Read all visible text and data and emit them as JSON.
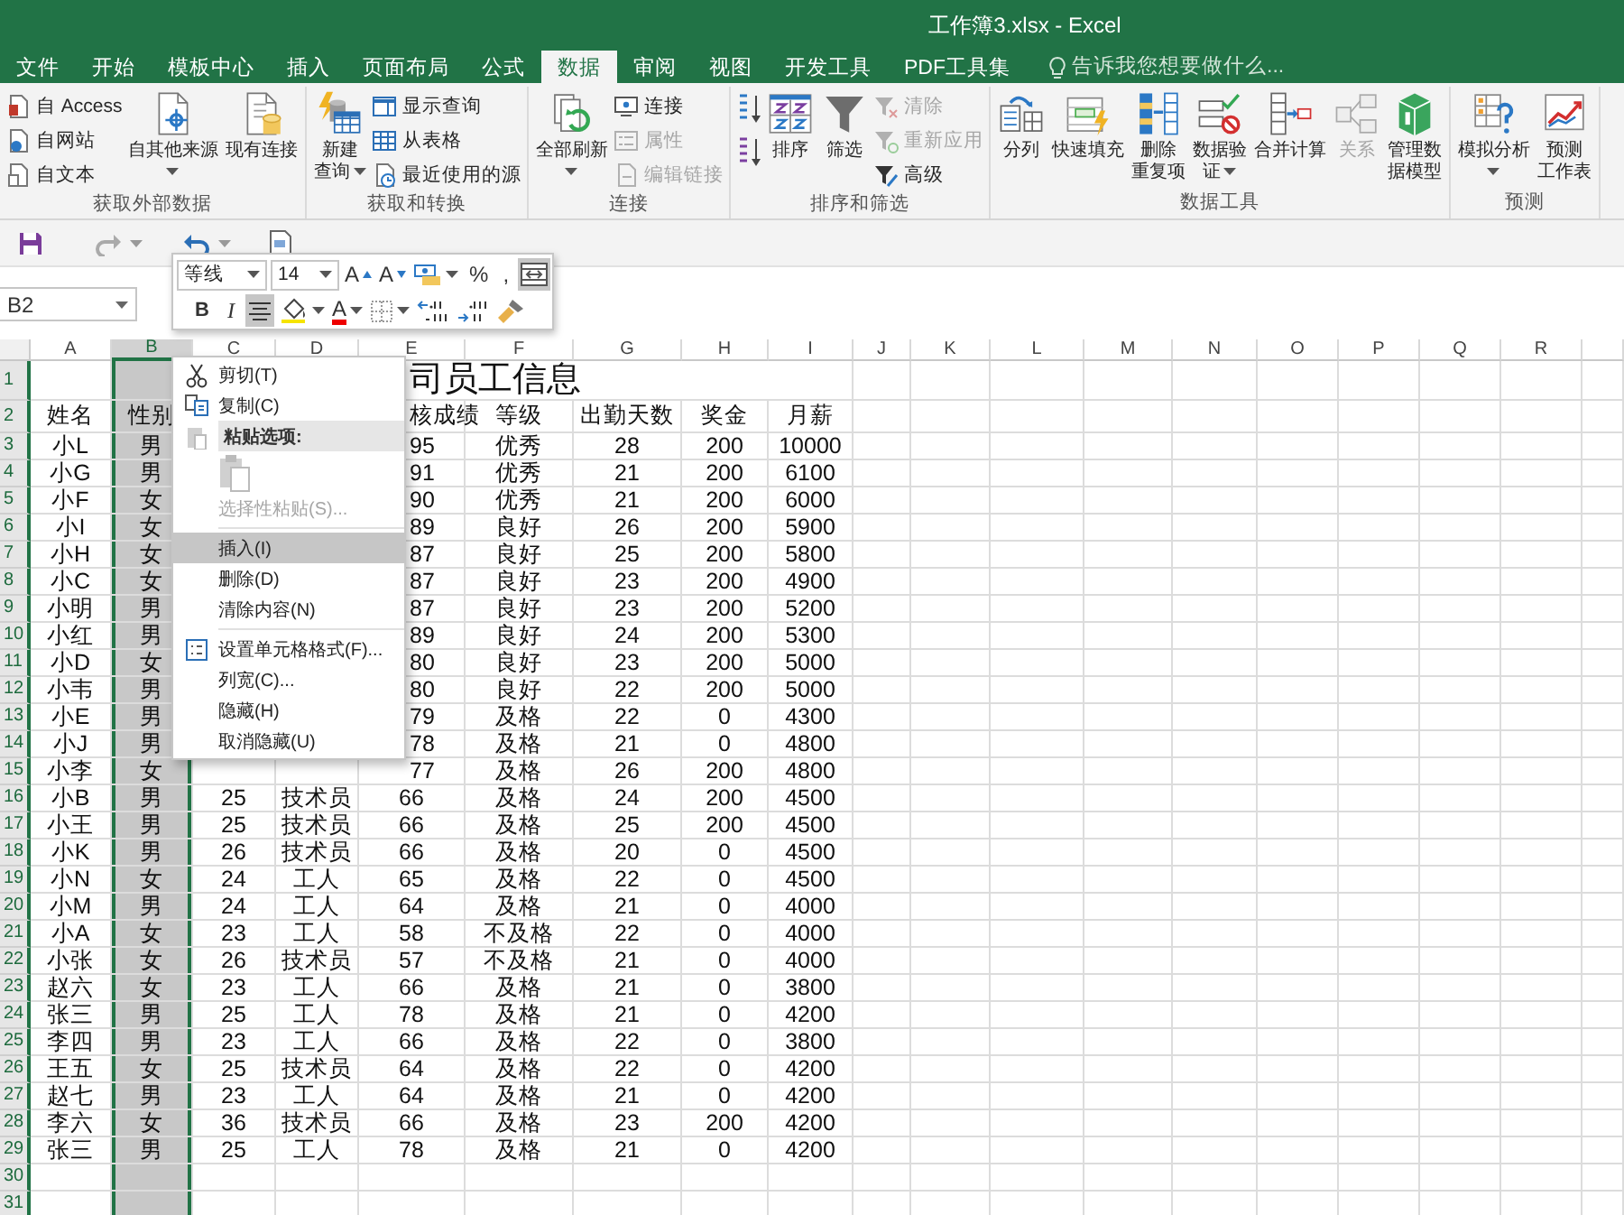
{
  "window": {
    "title": "工作簿3.xlsx - Excel"
  },
  "ribbon_tabs": [
    {
      "label": "文件",
      "selected": false
    },
    {
      "label": "开始",
      "selected": false
    },
    {
      "label": "模板中心",
      "selected": false
    },
    {
      "label": "插入",
      "selected": false
    },
    {
      "label": "页面布局",
      "selected": false
    },
    {
      "label": "公式",
      "selected": false
    },
    {
      "label": "数据",
      "selected": true
    },
    {
      "label": "审阅",
      "selected": false
    },
    {
      "label": "视图",
      "selected": false
    },
    {
      "label": "开发工具",
      "selected": false
    },
    {
      "label": "PDF工具集",
      "selected": false
    }
  ],
  "tell_me": {
    "placeholder": "告诉我您想要做什么..."
  },
  "ribbon_groups": [
    {
      "label": "获取外部数据",
      "items": [
        {
          "kind": "stack",
          "items": [
            {
              "label": "自 Access",
              "disabled": false
            },
            {
              "label": "自网站",
              "disabled": false
            },
            {
              "label": "自文本",
              "disabled": false
            }
          ]
        },
        {
          "kind": "large",
          "lines": [
            "自其他来源"
          ],
          "dropdown": true,
          "disabled": false
        },
        {
          "kind": "large",
          "lines": [
            "现有连接"
          ],
          "dropdown": false,
          "disabled": false
        }
      ]
    },
    {
      "label": "获取和转换",
      "items": [
        {
          "kind": "large",
          "lines": [
            "新建",
            "查询"
          ],
          "dropdown": true,
          "disabled": false
        },
        {
          "kind": "stack",
          "items": [
            {
              "label": "显示查询",
              "disabled": false
            },
            {
              "label": "从表格",
              "disabled": false
            },
            {
              "label": "最近使用的源",
              "disabled": false
            }
          ]
        }
      ]
    },
    {
      "label": "连接",
      "items": [
        {
          "kind": "large",
          "lines": [
            "全部刷新"
          ],
          "dropdown": true,
          "disabled": false
        },
        {
          "kind": "stack",
          "items": [
            {
              "label": "连接",
              "disabled": false
            },
            {
              "label": "属性",
              "disabled": true
            },
            {
              "label": "编辑链接",
              "disabled": true
            }
          ]
        }
      ]
    },
    {
      "label": "排序和筛选",
      "items": [
        {
          "kind": "sort-pair"
        },
        {
          "kind": "large",
          "lines": [
            "排序"
          ],
          "dropdown": false,
          "disabled": false
        },
        {
          "kind": "large",
          "lines": [
            "筛选"
          ],
          "dropdown": false,
          "disabled": false
        },
        {
          "kind": "stack",
          "items": [
            {
              "label": "清除",
              "disabled": true
            },
            {
              "label": "重新应用",
              "disabled": true
            },
            {
              "label": "高级",
              "disabled": false
            }
          ]
        }
      ]
    },
    {
      "label": "数据工具",
      "items": [
        {
          "kind": "large",
          "lines": [
            "分列"
          ],
          "dropdown": false,
          "disabled": false
        },
        {
          "kind": "large",
          "lines": [
            "快速填充"
          ],
          "dropdown": false,
          "disabled": false
        },
        {
          "kind": "large",
          "lines": [
            "删除",
            "重复项"
          ],
          "dropdown": false,
          "disabled": false
        },
        {
          "kind": "large",
          "lines": [
            "数据验",
            "证"
          ],
          "dropdown": true,
          "disabled": false
        },
        {
          "kind": "large",
          "lines": [
            "合并计算"
          ],
          "dropdown": false,
          "disabled": false
        },
        {
          "kind": "large",
          "lines": [
            "关系"
          ],
          "dropdown": false,
          "disabled": true
        },
        {
          "kind": "large",
          "lines": [
            "管理数",
            "据模型"
          ],
          "dropdown": false,
          "disabled": false
        }
      ]
    },
    {
      "label": "预测",
      "items": [
        {
          "kind": "large",
          "lines": [
            "模拟分析"
          ],
          "dropdown": true,
          "disabled": false
        },
        {
          "kind": "large",
          "lines": [
            "预测",
            "工作表"
          ],
          "dropdown": false,
          "disabled": false
        }
      ]
    }
  ],
  "name_box": "B2",
  "mini_toolbar": {
    "font": "等线",
    "size": "14",
    "row_1": [
      {
        "kind": "grow-font",
        "label": "A",
        "selected": false
      },
      {
        "kind": "shrink-font",
        "label": "A",
        "selected": false
      },
      {
        "kind": "accounting",
        "selected": false
      },
      {
        "kind": "percent",
        "label": "%",
        "selected": false
      },
      {
        "kind": "comma",
        "label": ",",
        "selected": false
      },
      {
        "kind": "merge",
        "selected": true
      }
    ],
    "row_2": [
      {
        "kind": "bold",
        "label": "B",
        "selected": false
      },
      {
        "kind": "italic",
        "label": "I",
        "selected": false
      },
      {
        "kind": "center",
        "selected": true
      },
      {
        "kind": "fill-color",
        "selected": false
      },
      {
        "kind": "font-color",
        "label": "A",
        "selected": false
      },
      {
        "kind": "borders",
        "selected": false
      },
      {
        "kind": "increase-decimal",
        "selected": false
      },
      {
        "kind": "decrease-decimal",
        "selected": false
      },
      {
        "kind": "format-painter",
        "selected": false
      }
    ]
  },
  "context_menu": [
    {
      "kind": "item",
      "label": "剪切(T)",
      "selected": false,
      "disabled": false
    },
    {
      "kind": "item",
      "label": "复制(C)",
      "selected": false,
      "disabled": false
    },
    {
      "kind": "header",
      "label": "粘贴选项:"
    },
    {
      "kind": "paste-options"
    },
    {
      "kind": "item",
      "label": "选择性粘贴(S)...",
      "selected": false,
      "disabled": true
    },
    {
      "kind": "separator"
    },
    {
      "kind": "item",
      "label": "插入(I)",
      "selected": true,
      "disabled": false
    },
    {
      "kind": "item",
      "label": "删除(D)",
      "selected": false,
      "disabled": false
    },
    {
      "kind": "item",
      "label": "清除内容(N)",
      "selected": false,
      "disabled": false
    },
    {
      "kind": "separator"
    },
    {
      "kind": "item",
      "label": "设置单元格格式(F)...",
      "selected": false,
      "disabled": false
    },
    {
      "kind": "item",
      "label": "列宽(C)...",
      "selected": false,
      "disabled": false
    },
    {
      "kind": "item",
      "label": "隐藏(H)",
      "selected": false,
      "disabled": false
    },
    {
      "kind": "item",
      "label": "取消隐藏(U)",
      "selected": false,
      "disabled": false
    }
  ],
  "sheet": {
    "columns": [
      {
        "label": "A",
        "selected": false
      },
      {
        "label": "B",
        "selected": true
      },
      {
        "label": "C",
        "selected": false
      },
      {
        "label": "D",
        "selected": false
      },
      {
        "label": "E",
        "selected": false
      },
      {
        "label": "F",
        "selected": false
      },
      {
        "label": "G",
        "selected": false
      },
      {
        "label": "H",
        "selected": false
      },
      {
        "label": "I",
        "selected": false
      },
      {
        "label": "J",
        "selected": false
      },
      {
        "label": "K",
        "selected": false
      },
      {
        "label": "L",
        "selected": false
      },
      {
        "label": "M",
        "selected": false
      },
      {
        "label": "N",
        "selected": false
      },
      {
        "label": "O",
        "selected": false
      },
      {
        "label": "P",
        "selected": false
      },
      {
        "label": "Q",
        "selected": false
      },
      {
        "label": "R",
        "selected": false
      }
    ],
    "rows": [
      {
        "number": "1",
        "kind": "title",
        "cells": {
          "E": "司员工信息"
        }
      },
      {
        "number": "2",
        "kind": "header",
        "cells": {
          "A": "姓名",
          "B": "性别",
          "E": "核成绩",
          "F": "等级",
          "G": "出勤天数",
          "H": "奖金",
          "I": "月薪"
        }
      },
      {
        "number": "3",
        "kind": "data",
        "cells": {
          "A": "小L",
          "B": "男",
          "E": "95",
          "F": "优秀",
          "G": "28",
          "H": "200",
          "I": "10000"
        }
      },
      {
        "number": "4",
        "kind": "data",
        "cells": {
          "A": "小G",
          "B": "男",
          "E": "91",
          "F": "优秀",
          "G": "21",
          "H": "200",
          "I": "6100"
        }
      },
      {
        "number": "5",
        "kind": "data",
        "cells": {
          "A": "小F",
          "B": "女",
          "E": "90",
          "F": "优秀",
          "G": "21",
          "H": "200",
          "I": "6000"
        }
      },
      {
        "number": "6",
        "kind": "data",
        "cells": {
          "A": "小I",
          "B": "女",
          "E": "89",
          "F": "良好",
          "G": "26",
          "H": "200",
          "I": "5900"
        }
      },
      {
        "number": "7",
        "kind": "data",
        "cells": {
          "A": "小H",
          "B": "女",
          "E": "87",
          "F": "良好",
          "G": "25",
          "H": "200",
          "I": "5800"
        }
      },
      {
        "number": "8",
        "kind": "data",
        "cells": {
          "A": "小C",
          "B": "女",
          "E": "87",
          "F": "良好",
          "G": "23",
          "H": "200",
          "I": "4900"
        }
      },
      {
        "number": "9",
        "kind": "data",
        "cells": {
          "A": "小明",
          "B": "男",
          "E": "87",
          "F": "良好",
          "G": "23",
          "H": "200",
          "I": "5200"
        }
      },
      {
        "number": "10",
        "kind": "data",
        "cells": {
          "A": "小红",
          "B": "男",
          "E": "89",
          "F": "良好",
          "G": "24",
          "H": "200",
          "I": "5300"
        }
      },
      {
        "number": "11",
        "kind": "data",
        "cells": {
          "A": "小D",
          "B": "女",
          "E": "80",
          "F": "良好",
          "G": "23",
          "H": "200",
          "I": "5000"
        }
      },
      {
        "number": "12",
        "kind": "data",
        "cells": {
          "A": "小韦",
          "B": "男",
          "E": "80",
          "F": "良好",
          "G": "22",
          "H": "200",
          "I": "5000"
        }
      },
      {
        "number": "13",
        "kind": "data",
        "cells": {
          "A": "小E",
          "B": "男",
          "E": "79",
          "F": "及格",
          "G": "22",
          "H": "0",
          "I": "4300"
        }
      },
      {
        "number": "14",
        "kind": "data",
        "cells": {
          "A": "小J",
          "B": "男",
          "E": "78",
          "F": "及格",
          "G": "21",
          "H": "0",
          "I": "4800"
        }
      },
      {
        "number": "15",
        "kind": "data",
        "cells": {
          "A": "小李",
          "B": "女",
          "E": "77",
          "F": "及格",
          "G": "26",
          "H": "200",
          "I": "4800"
        }
      },
      {
        "number": "16",
        "kind": "data",
        "cells": {
          "A": "小B",
          "B": "男",
          "C": "25",
          "D": "技术员",
          "E": "66",
          "F": "及格",
          "G": "24",
          "H": "200",
          "I": "4500"
        }
      },
      {
        "number": "17",
        "kind": "data",
        "cells": {
          "A": "小王",
          "B": "男",
          "C": "25",
          "D": "技术员",
          "E": "66",
          "F": "及格",
          "G": "25",
          "H": "200",
          "I": "4500"
        }
      },
      {
        "number": "18",
        "kind": "data",
        "cells": {
          "A": "小K",
          "B": "男",
          "C": "26",
          "D": "技术员",
          "E": "66",
          "F": "及格",
          "G": "20",
          "H": "0",
          "I": "4500"
        }
      },
      {
        "number": "19",
        "kind": "data",
        "cells": {
          "A": "小N",
          "B": "女",
          "C": "24",
          "D": "工人",
          "E": "65",
          "F": "及格",
          "G": "22",
          "H": "0",
          "I": "4500"
        }
      },
      {
        "number": "20",
        "kind": "data",
        "cells": {
          "A": "小M",
          "B": "男",
          "C": "24",
          "D": "工人",
          "E": "64",
          "F": "及格",
          "G": "21",
          "H": "0",
          "I": "4000"
        }
      },
      {
        "number": "21",
        "kind": "data",
        "cells": {
          "A": "小A",
          "B": "女",
          "C": "23",
          "D": "工人",
          "E": "58",
          "F": "不及格",
          "G": "22",
          "H": "0",
          "I": "4000"
        }
      },
      {
        "number": "22",
        "kind": "data",
        "cells": {
          "A": "小张",
          "B": "女",
          "C": "26",
          "D": "技术员",
          "E": "57",
          "F": "不及格",
          "G": "21",
          "H": "0",
          "I": "4000"
        }
      },
      {
        "number": "23",
        "kind": "data",
        "cells": {
          "A": "赵六",
          "B": "女",
          "C": "23",
          "D": "工人",
          "E": "66",
          "F": "及格",
          "G": "21",
          "H": "0",
          "I": "3800"
        }
      },
      {
        "number": "24",
        "kind": "data",
        "cells": {
          "A": "张三",
          "B": "男",
          "C": "25",
          "D": "工人",
          "E": "78",
          "F": "及格",
          "G": "21",
          "H": "0",
          "I": "4200"
        }
      },
      {
        "number": "25",
        "kind": "data",
        "cells": {
          "A": "李四",
          "B": "男",
          "C": "23",
          "D": "工人",
          "E": "66",
          "F": "及格",
          "G": "22",
          "H": "0",
          "I": "3800"
        }
      },
      {
        "number": "26",
        "kind": "data",
        "cells": {
          "A": "王五",
          "B": "女",
          "C": "25",
          "D": "技术员",
          "E": "64",
          "F": "及格",
          "G": "22",
          "H": "0",
          "I": "4200"
        }
      },
      {
        "number": "27",
        "kind": "data",
        "cells": {
          "A": "赵七",
          "B": "男",
          "C": "23",
          "D": "工人",
          "E": "64",
          "F": "及格",
          "G": "21",
          "H": "0",
          "I": "4200"
        }
      },
      {
        "number": "28",
        "kind": "data",
        "cells": {
          "A": "李六",
          "B": "女",
          "C": "36",
          "D": "技术员",
          "E": "66",
          "F": "及格",
          "G": "23",
          "H": "200",
          "I": "4200"
        }
      },
      {
        "number": "29",
        "kind": "data",
        "cells": {
          "A": "张三",
          "B": "男",
          "C": "25",
          "D": "工人",
          "E": "78",
          "F": "及格",
          "G": "21",
          "H": "0",
          "I": "4200"
        }
      },
      {
        "number": "30",
        "kind": "data",
        "cells": {}
      },
      {
        "number": "31",
        "kind": "data",
        "cells": {}
      }
    ]
  }
}
